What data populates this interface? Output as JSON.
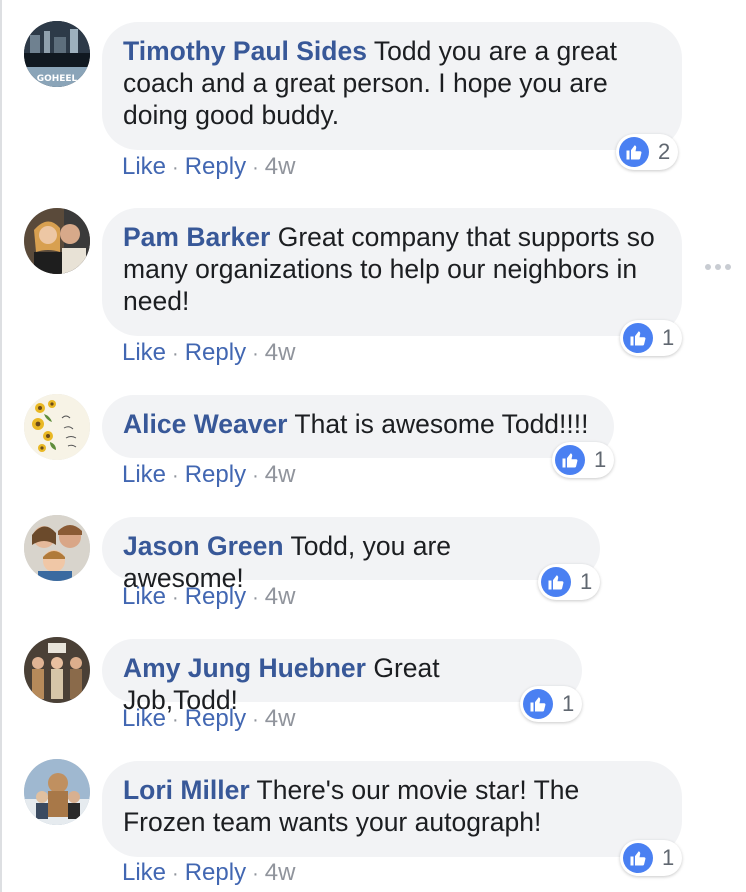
{
  "comments": [
    {
      "author": "Timothy Paul Sides",
      "text": "Todd you are a great coach and a great person. I hope you are doing good buddy.",
      "like_label": "Like",
      "reply_label": "Reply",
      "time": "4w",
      "reaction_count": "2",
      "avatar_caption": "GOHEEL"
    },
    {
      "author": "Pam Barker",
      "text": "Great company that supports so many organizations to help our neighbors in need!",
      "like_label": "Like",
      "reply_label": "Reply",
      "time": "4w",
      "reaction_count": "1"
    },
    {
      "author": "Alice Weaver",
      "text": "That is awesome Todd!!!!",
      "like_label": "Like",
      "reply_label": "Reply",
      "time": "4w",
      "reaction_count": "1"
    },
    {
      "author": "Jason Green",
      "text": "Todd, you are awesome!",
      "like_label": "Like",
      "reply_label": "Reply",
      "time": "4w",
      "reaction_count": "1"
    },
    {
      "author": "Amy Jung Huebner",
      "text": "Great Job,Todd!",
      "like_label": "Like",
      "reply_label": "Reply",
      "time": "4w",
      "reaction_count": "1"
    },
    {
      "author": "Lori Miller",
      "text": "There's our movie star! The Frozen team wants your autograph!",
      "like_label": "Like",
      "reply_label": "Reply",
      "time": "4w",
      "reaction_count": "1"
    }
  ],
  "icons": {
    "reaction": "like-thumb-icon",
    "more": "more-options-icon"
  },
  "colors": {
    "author": "#385898",
    "link": "#4267b2",
    "bubble": "#f2f3f5",
    "like_badge": "#4a80f2",
    "meta": "#90949c"
  }
}
